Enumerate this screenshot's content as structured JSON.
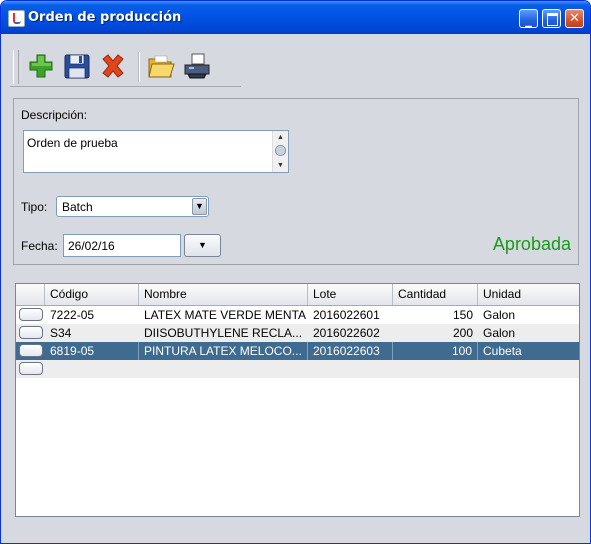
{
  "window": {
    "title": "Orden de producción"
  },
  "toolbar": {
    "items": [
      {
        "name": "new",
        "icon": "plus-icon"
      },
      {
        "name": "save",
        "icon": "floppy-icon"
      },
      {
        "name": "delete",
        "icon": "red-x-icon"
      },
      {
        "name": "open",
        "icon": "folder-icon"
      },
      {
        "name": "print",
        "icon": "printer-icon"
      }
    ]
  },
  "form": {
    "descripcion_label": "Descripción:",
    "descripcion_value": "Orden de prueba",
    "tipo_label": "Tipo:",
    "tipo_value": "Batch",
    "fecha_label": "Fecha:",
    "fecha_value": "26/02/16",
    "status_text": "Aprobada",
    "status_color": "#1a9a1a"
  },
  "table": {
    "columns": [
      "Código",
      "Nombre",
      "Lote",
      "Cantidad",
      "Unidad"
    ],
    "rows": [
      {
        "codigo": "7222-05",
        "nombre": "LATEX MATE VERDE MENTA",
        "lote": "2016022601",
        "cantidad": "150",
        "unidad": "Galon",
        "selected": false
      },
      {
        "codigo": "S34",
        "nombre": "DIISOBUTHYLENE RECLA...",
        "lote": "2016022602",
        "cantidad": "200",
        "unidad": "Galon",
        "selected": false
      },
      {
        "codigo": "6819-05",
        "nombre": "PINTURA LATEX MELOCO...",
        "lote": "2016022603",
        "cantidad": "100",
        "unidad": "Cubeta",
        "selected": true
      }
    ],
    "selected_color": "#3e6b8f"
  }
}
